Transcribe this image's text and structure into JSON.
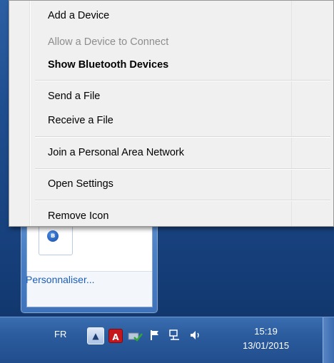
{
  "context_menu": {
    "items": [
      {
        "label": "Add a Device",
        "state": "enabled"
      },
      {
        "label": "Allow a Device to Connect",
        "state": "disabled"
      },
      {
        "label": "Show Bluetooth Devices",
        "state": "default"
      },
      {
        "label": "Send a File",
        "state": "enabled"
      },
      {
        "label": "Receive a File",
        "state": "enabled"
      },
      {
        "label": "Join a Personal Area Network",
        "state": "enabled"
      },
      {
        "label": "Open Settings",
        "state": "enabled"
      },
      {
        "label": "Remove Icon",
        "state": "enabled"
      }
    ]
  },
  "tray_flyout": {
    "customize_link": "Personnaliser..."
  },
  "taskbar": {
    "language": "FR",
    "time": "15:19",
    "date": "13/01/2015",
    "icons": [
      "show-hidden-icons",
      "adobe-icon",
      "windows-update-icon",
      "action-center-flag-icon",
      "network-icon",
      "volume-icon"
    ]
  },
  "colors": {
    "taskbar": "#214d8c",
    "menu_background": "#f0f0f0",
    "link": "#1b5eb8"
  }
}
